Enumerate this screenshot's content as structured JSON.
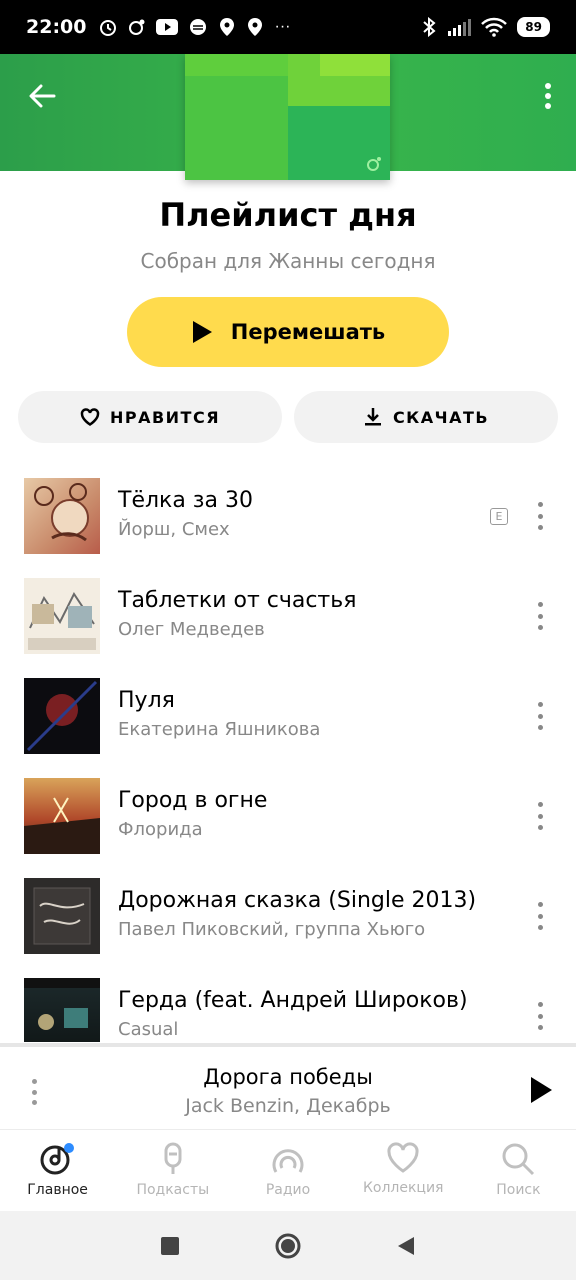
{
  "status_bar": {
    "time": "22:00",
    "more": "···",
    "battery": "89"
  },
  "playlist": {
    "title": "Плейлист дня",
    "subtitle": "Собран для Жанны сегодня",
    "shuffle_label": "Перемешать",
    "like_label": "НРАВИТСЯ",
    "download_label": "СКАЧАТЬ"
  },
  "tracks": [
    {
      "title": "Тёлка за 30",
      "artist": "Йорш, Смех",
      "explicit": "E"
    },
    {
      "title": "Таблетки от счастья",
      "artist": "Олег Медведев"
    },
    {
      "title": "Пуля",
      "artist": "Екатерина Яшникова"
    },
    {
      "title": "Город в огне",
      "artist": "Флорида"
    },
    {
      "title": "Дорожная сказка (Single 2013)",
      "artist": "Павел Пиковский, группа Хьюго"
    },
    {
      "title": "Герда (feat. Андрей Широков)",
      "artist": "Casual"
    }
  ],
  "mini_player": {
    "title": "Дорога победы",
    "artist": "Jack Benzin, Декабрь"
  },
  "nav": {
    "home": "Главное",
    "podcasts": "Подкасты",
    "radio": "Радио",
    "collection": "Коллекция",
    "search": "Поиск"
  },
  "colors": {
    "accent_yellow": "#ffdb4d",
    "header_green": "#39b54a",
    "nav_active_dot": "#2d8cff"
  }
}
